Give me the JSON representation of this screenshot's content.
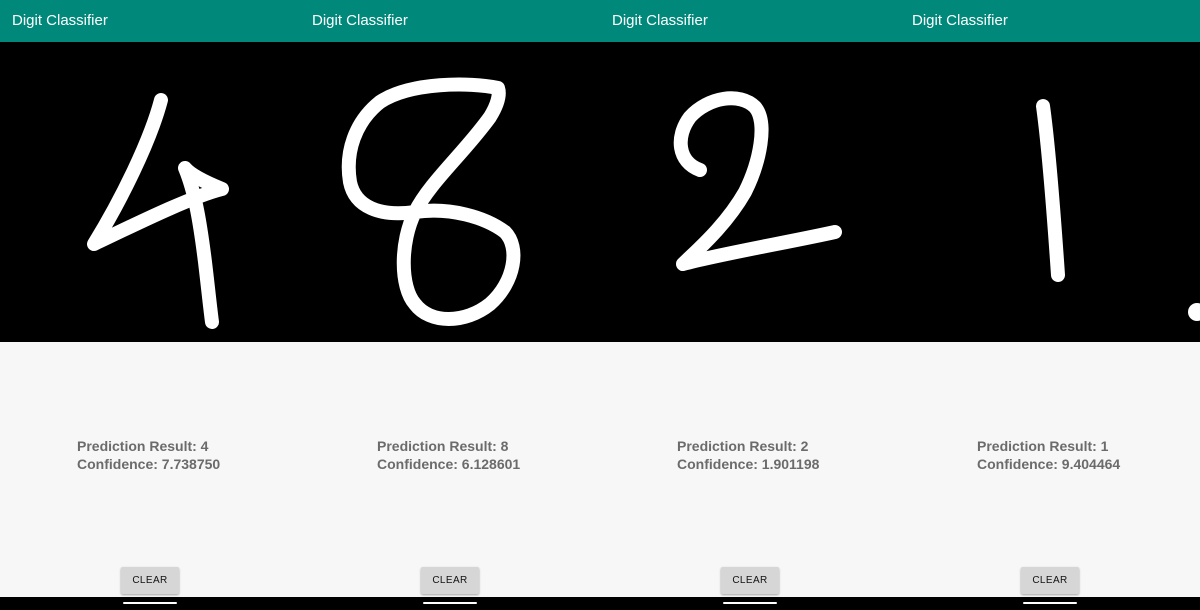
{
  "screens": [
    {
      "app_title": "Digit Classifier",
      "prediction_text": "Prediction Result: 4",
      "confidence_text": "Confidence: 7.738750",
      "clear_label": "CLEAR",
      "drawn_digit": "4"
    },
    {
      "app_title": "Digit Classifier",
      "prediction_text": "Prediction Result: 8",
      "confidence_text": "Confidence: 6.128601",
      "clear_label": "CLEAR",
      "drawn_digit": "8"
    },
    {
      "app_title": "Digit Classifier",
      "prediction_text": "Prediction Result: 2",
      "confidence_text": "Confidence: 1.901198",
      "clear_label": "CLEAR",
      "drawn_digit": "2"
    },
    {
      "app_title": "Digit Classifier",
      "prediction_text": "Prediction Result: 1",
      "confidence_text": "Confidence: 9.404464",
      "clear_label": "CLEAR",
      "drawn_digit": "1"
    }
  ],
  "colors": {
    "app_bar": "#00897b",
    "canvas_background": "#000000",
    "stroke": "#ffffff",
    "body_background": "#f7f7f7",
    "result_text": "#6b6b6b",
    "button_background": "#d6d6d6"
  }
}
